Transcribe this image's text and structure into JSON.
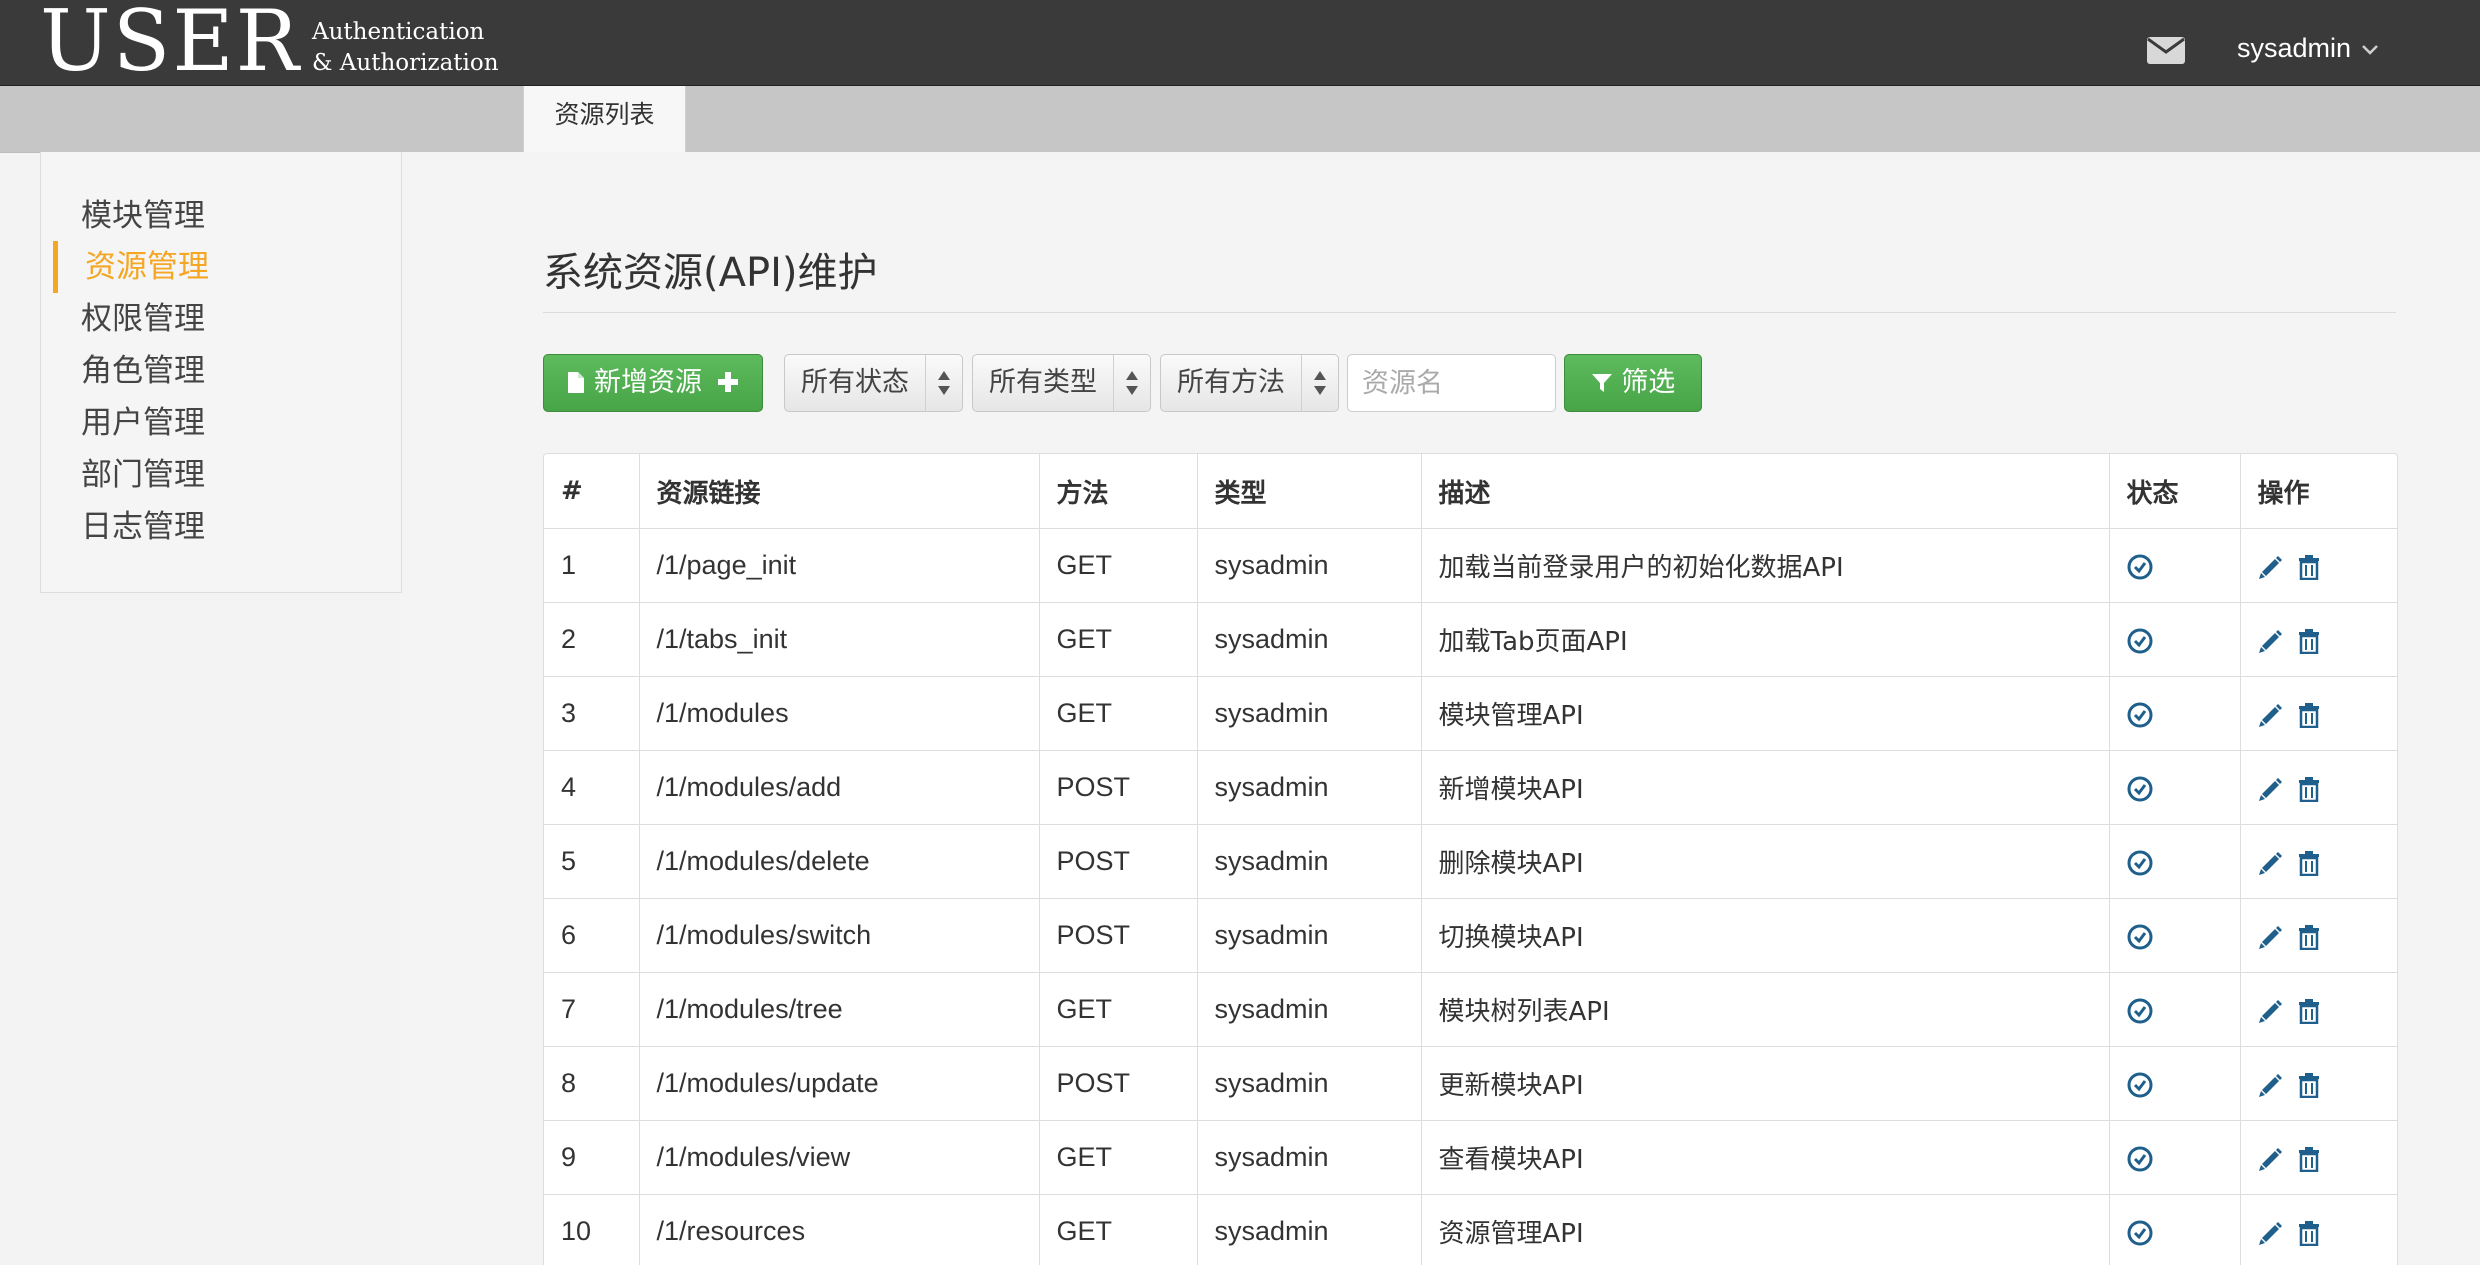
{
  "brand": {
    "main": "USER",
    "sub_line1": "Authentication",
    "sub_line2": "& Authorization"
  },
  "header": {
    "username": "sysadmin",
    "mail_icon": "envelope-icon",
    "dropdown_icon": "chevron-down-icon"
  },
  "tabs": [
    {
      "label": "资源列表",
      "active": true
    }
  ],
  "sidebar": {
    "items": [
      {
        "label": "模块管理",
        "active": false
      },
      {
        "label": "资源管理",
        "active": true
      },
      {
        "label": "权限管理",
        "active": false
      },
      {
        "label": "角色管理",
        "active": false
      },
      {
        "label": "用户管理",
        "active": false
      },
      {
        "label": "部门管理",
        "active": false
      },
      {
        "label": "日志管理",
        "active": false
      }
    ]
  },
  "main": {
    "title": "系统资源(API)维护",
    "add_button": "新增资源",
    "filters": {
      "status": "所有状态",
      "type": "所有类型",
      "method": "所有方法",
      "name_placeholder": "资源名",
      "filter_button": "筛选"
    },
    "table": {
      "columns": [
        "#",
        "资源链接",
        "方法",
        "类型",
        "描述",
        "状态",
        "操作"
      ],
      "rows": [
        {
          "id": "1",
          "url": "/1/page_init",
          "method": "GET",
          "type": "sysadmin",
          "desc": "加载当前登录用户的初始化数据API"
        },
        {
          "id": "2",
          "url": "/1/tabs_init",
          "method": "GET",
          "type": "sysadmin",
          "desc": "加载Tab页面API"
        },
        {
          "id": "3",
          "url": "/1/modules",
          "method": "GET",
          "type": "sysadmin",
          "desc": "模块管理API"
        },
        {
          "id": "4",
          "url": "/1/modules/add",
          "method": "POST",
          "type": "sysadmin",
          "desc": "新增模块API"
        },
        {
          "id": "5",
          "url": "/1/modules/delete",
          "method": "POST",
          "type": "sysadmin",
          "desc": "删除模块API"
        },
        {
          "id": "6",
          "url": "/1/modules/switch",
          "method": "POST",
          "type": "sysadmin",
          "desc": "切换模块API"
        },
        {
          "id": "7",
          "url": "/1/modules/tree",
          "method": "GET",
          "type": "sysadmin",
          "desc": "模块树列表API"
        },
        {
          "id": "8",
          "url": "/1/modules/update",
          "method": "POST",
          "type": "sysadmin",
          "desc": "更新模块API"
        },
        {
          "id": "9",
          "url": "/1/modules/view",
          "method": "GET",
          "type": "sysadmin",
          "desc": "查看模块API"
        },
        {
          "id": "10",
          "url": "/1/resources",
          "method": "GET",
          "type": "sysadmin",
          "desc": "资源管理API"
        }
      ]
    }
  },
  "colors": {
    "navbar": "#3a3a3a",
    "accent": "#f5a623",
    "green": "#47a447",
    "link_icon": "#1f5f8b"
  }
}
